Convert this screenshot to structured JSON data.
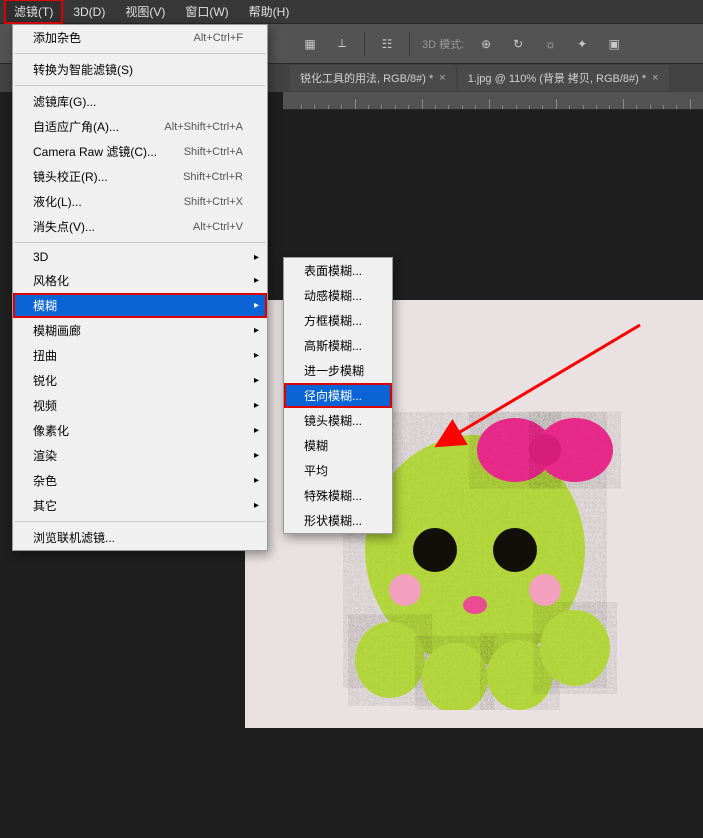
{
  "menubar": {
    "items": [
      "滤镜(T)",
      "3D(D)",
      "视图(V)",
      "窗口(W)",
      "帮助(H)"
    ],
    "active_index": 0
  },
  "toolbar": {
    "mode_label": "3D 模式:"
  },
  "tabs": [
    {
      "label": "锐化工具的用法, RGB/8#) *"
    },
    {
      "label": "1.jpg @ 110% (背景 拷贝, RGB/8#) *"
    }
  ],
  "filter_menu": [
    {
      "label": "添加杂色",
      "shortcut": "Alt+Ctrl+F"
    },
    {
      "sep": true
    },
    {
      "label": "转换为智能滤镜(S)"
    },
    {
      "sep": true
    },
    {
      "label": "滤镜库(G)..."
    },
    {
      "label": "自适应广角(A)...",
      "shortcut": "Alt+Shift+Ctrl+A"
    },
    {
      "label": "Camera Raw 滤镜(C)...",
      "shortcut": "Shift+Ctrl+A"
    },
    {
      "label": "镜头校正(R)...",
      "shortcut": "Shift+Ctrl+R"
    },
    {
      "label": "液化(L)...",
      "shortcut": "Shift+Ctrl+X"
    },
    {
      "label": "消失点(V)...",
      "shortcut": "Alt+Ctrl+V"
    },
    {
      "sep": true
    },
    {
      "label": "3D",
      "submenu": true
    },
    {
      "label": "风格化",
      "submenu": true
    },
    {
      "label": "模糊",
      "submenu": true,
      "highlighted": true,
      "boxed": true
    },
    {
      "label": "模糊画廊",
      "submenu": true
    },
    {
      "label": "扭曲",
      "submenu": true
    },
    {
      "label": "锐化",
      "submenu": true
    },
    {
      "label": "视频",
      "submenu": true
    },
    {
      "label": "像素化",
      "submenu": true
    },
    {
      "label": "渲染",
      "submenu": true
    },
    {
      "label": "杂色",
      "submenu": true
    },
    {
      "label": "其它",
      "submenu": true
    },
    {
      "sep": true
    },
    {
      "label": "浏览联机滤镜..."
    }
  ],
  "blur_submenu": [
    {
      "label": "表面模糊..."
    },
    {
      "label": "动感模糊..."
    },
    {
      "label": "方框模糊..."
    },
    {
      "label": "高斯模糊..."
    },
    {
      "label": "进一步模糊"
    },
    {
      "label": "径向模糊...",
      "highlighted": true,
      "boxed": true
    },
    {
      "label": "镜头模糊..."
    },
    {
      "label": "模糊"
    },
    {
      "label": "平均"
    },
    {
      "label": "特殊模糊..."
    },
    {
      "label": "形状模糊..."
    }
  ],
  "highlight_color": "#0a64d6",
  "box_color": "#d00",
  "arrow_color": "#ff0000"
}
